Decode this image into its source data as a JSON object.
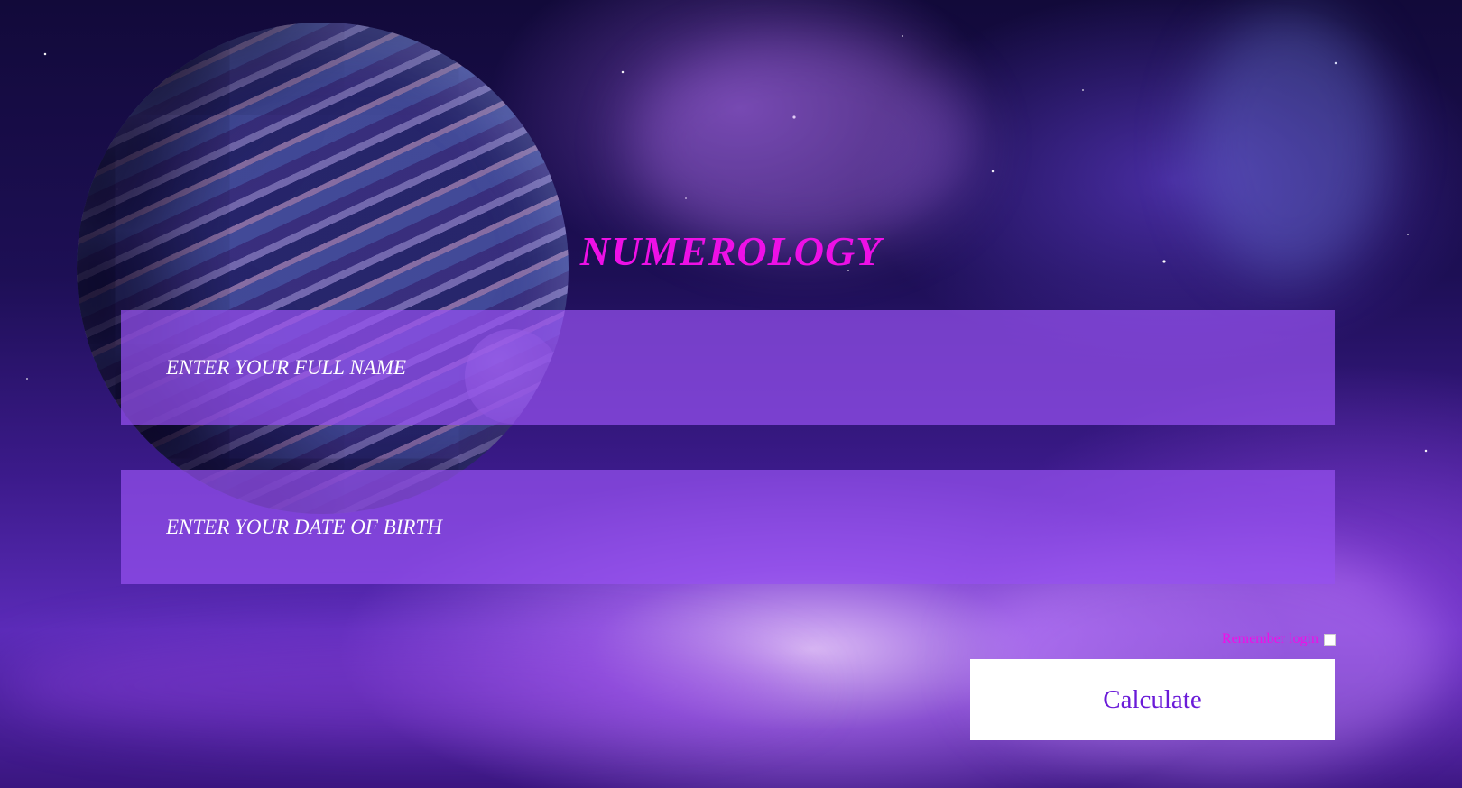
{
  "header": {
    "title": "NUMEROLOGY"
  },
  "form": {
    "name_placeholder": "ENTER YOUR FULL NAME",
    "dob_placeholder": "ENTER YOUR DATE OF BIRTH",
    "name_value": "",
    "dob_value": "",
    "remember_label": "Remember login",
    "remember_checked": false,
    "submit_label": "Calculate"
  },
  "colors": {
    "accent": "#ee10e6",
    "field_background": "#9650f0",
    "button_text": "#6a1bd8"
  }
}
